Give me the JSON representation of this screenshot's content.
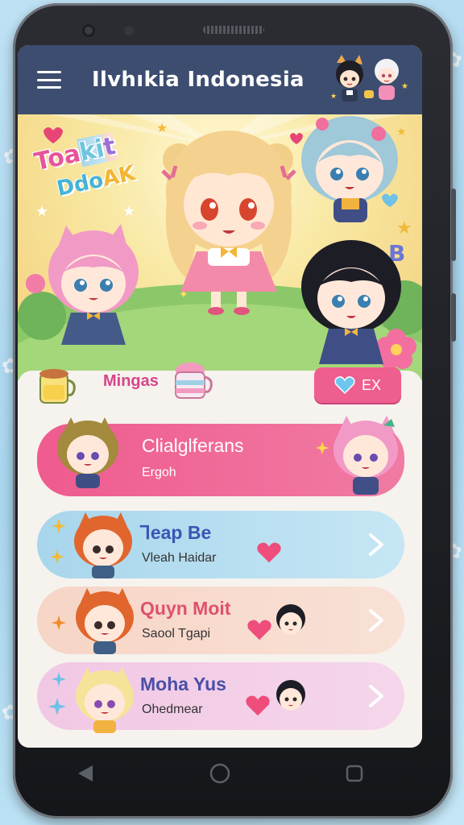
{
  "app": {
    "title": "Ilvhıkia Indonesia"
  },
  "hero": {
    "logo_line1_a": "Toa",
    "logo_line1_b": "ki",
    "logo_line1_c": "t",
    "logo_line2_a": "Ddo",
    "logo_line2_b": "AK"
  },
  "section": {
    "title": "Mingas",
    "ex_button_label": "EX"
  },
  "cards": [
    {
      "title": "Clialglferans",
      "subtitle": "Ergoh"
    },
    {
      "title": "Ꞁeap Be",
      "subtitle": "Vleah Haidar"
    },
    {
      "title": "Quyn Moit",
      "subtitle": "Saool Tgapi"
    },
    {
      "title": "Moha Yus",
      "subtitle": "Ohedmear"
    }
  ],
  "colors": {
    "appbar": "#3d4d70",
    "accent_pink": "#ee5e8f",
    "card_blue": "#a8d6ec",
    "card_peach": "#f6d5c6",
    "card_lilac": "#f1c8e4"
  },
  "icons": {
    "menu": "hamburger-menu-icon",
    "heart": "heart-icon",
    "chevron": "chevron-right-icon",
    "nav_back": "back-triangle-icon",
    "nav_home": "home-circle-icon",
    "nav_recent": "recent-square-icon"
  }
}
